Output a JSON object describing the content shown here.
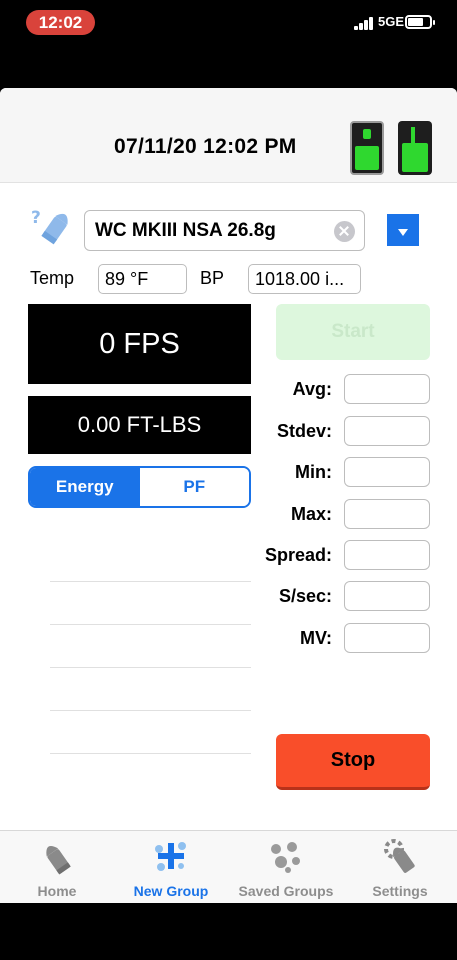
{
  "status_bar": {
    "time": "12:02",
    "network": "5GE"
  },
  "header": {
    "datetime": "07/11/20 12:02 PM"
  },
  "projectile": {
    "value": "WC MKIII NSA 26.8g"
  },
  "conditions": {
    "temp_label": "Temp",
    "temp_value": "89 °F",
    "bp_label": "BP",
    "bp_value": "1018.00 i..."
  },
  "readout": {
    "velocity": "0 FPS",
    "energy": "0.00 FT-LBS"
  },
  "segment": {
    "energy_label": "Energy",
    "pf_label": "PF",
    "selected": "Energy"
  },
  "buttons": {
    "start": "Start",
    "stop": "Stop"
  },
  "stats": [
    {
      "label": "Avg:",
      "value": ""
    },
    {
      "label": "Stdev:",
      "value": ""
    },
    {
      "label": "Min:",
      "value": ""
    },
    {
      "label": "Max:",
      "value": ""
    },
    {
      "label": "Spread:",
      "value": ""
    },
    {
      "label": "S/sec:",
      "value": ""
    },
    {
      "label": "MV:",
      "value": ""
    }
  ],
  "tabs": [
    {
      "label": "Home",
      "icon": "home-bullet-icon"
    },
    {
      "label": "New Group",
      "icon": "new-group-plus-icon"
    },
    {
      "label": "Saved Groups",
      "icon": "saved-groups-icon"
    },
    {
      "label": "Settings",
      "icon": "settings-bullet-icon"
    }
  ],
  "colors": {
    "accent": "#1a73e8",
    "start_bg": "#ddf7dd",
    "stop_bg": "#f94e2a",
    "device_green": "#2fd82f",
    "time_pill": "#d9433b"
  }
}
